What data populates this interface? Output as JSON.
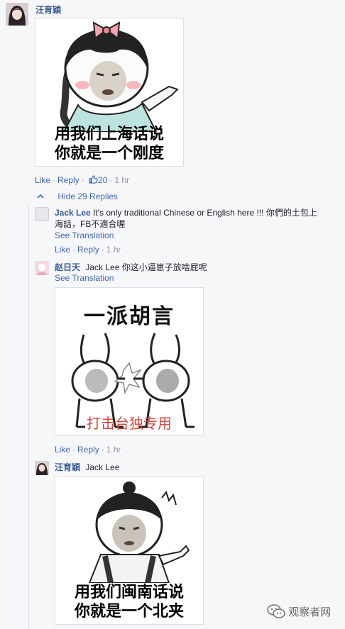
{
  "comment1": {
    "author": "汪育穎",
    "actions": {
      "like": "Like",
      "reply": "Reply",
      "likes_count": "20",
      "time": "1 hr"
    }
  },
  "meme1": {
    "caption_line1": "用我们上海话说",
    "caption_line2": "你就是一个刚度"
  },
  "hide_replies": "Hide 29 Replies",
  "reply1": {
    "author": "Jack Lee",
    "text": "It's only traditional Chinese or English here !!! 你們的土包上海話，FB不適合喔",
    "see_translation": "See Translation",
    "actions": {
      "like": "Like",
      "reply": "Reply",
      "time": "1 hr"
    }
  },
  "reply2": {
    "author": "赵日天",
    "mention": "Jack Lee",
    "text": "你这小逼崽子放啥屁呢",
    "see_translation": "See Translation",
    "actions": {
      "like": "Like",
      "reply": "Reply",
      "time": "1 hr"
    }
  },
  "meme2": {
    "title": "一派胡言",
    "subtitle": "打击台独专用"
  },
  "reply3": {
    "author": "汪育穎",
    "mention": "Jack Lee"
  },
  "meme3": {
    "caption_line1": "用我们闽南话说",
    "caption_line2": "你就是一个北夹"
  },
  "watermark": "观察者网",
  "colors": {
    "link": "#4267b2",
    "name": "#365899",
    "meta": "#90949c",
    "bg": "#f6f7f9"
  }
}
